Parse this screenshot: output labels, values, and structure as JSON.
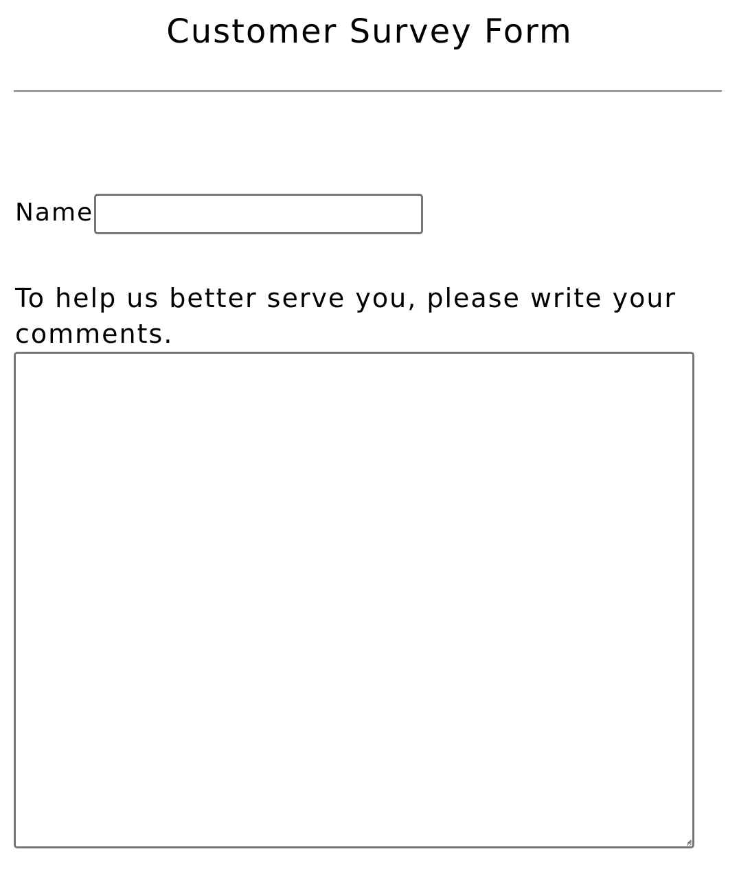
{
  "page": {
    "title": "Customer Survey Form"
  },
  "form": {
    "name_label": "Name",
    "name_value": "",
    "name_placeholder": "",
    "comments_label": "To help us better serve you, please write your comments.",
    "comments_value": "",
    "comments_placeholder": ""
  },
  "icons": {
    "resize_grip": "resize-grip-icon"
  },
  "colors": {
    "divider": "#999999",
    "field_border": "#767676",
    "text": "#000000",
    "background": "#ffffff"
  }
}
